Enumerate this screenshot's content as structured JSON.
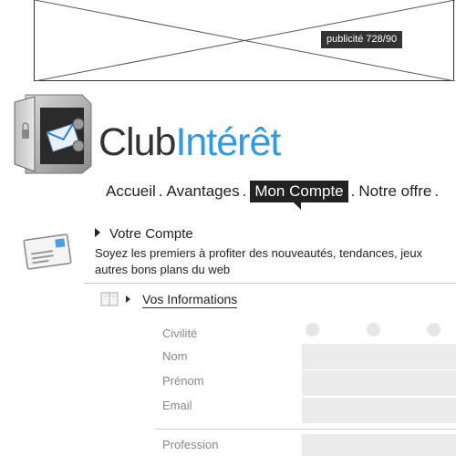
{
  "ad": {
    "label": "publicité 728/90"
  },
  "logo": {
    "part1": "Club",
    "part2": "Intérêt"
  },
  "nav": {
    "items": [
      {
        "label": "Accueil"
      },
      {
        "label": "Avantages"
      },
      {
        "label": "Mon Compte",
        "active": true
      },
      {
        "label": "Notre offre"
      }
    ],
    "separator": "."
  },
  "account": {
    "title": "Votre Compte",
    "description_line1": "Soyez les premiers à profiter des nouveautés, tendances, jeux",
    "description_line2": "autres bons plans du web"
  },
  "section": {
    "title": "Vos Informations"
  },
  "form": {
    "civilite_label": "Civilité",
    "nom_label": "Nom",
    "prenom_label": "Prénom",
    "email_label": "Email",
    "profession_label": "Profession"
  },
  "colors": {
    "brand_blue": "#2c9be6",
    "dark": "#222222",
    "field_bg": "#ececec"
  }
}
